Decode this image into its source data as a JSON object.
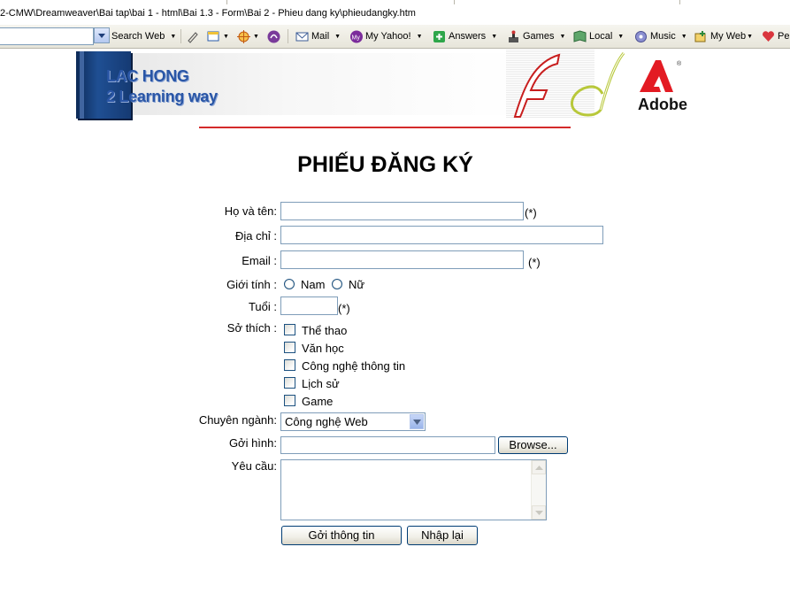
{
  "browser": {
    "path": "2-CMW\\Dreamweaver\\Bai tap\\bai 1 - html\\Bai 1.3 - Form\\Bai 2 - Phieu dang ky\\phieudangky.htm",
    "toolbar": {
      "search_label": "Search Web",
      "items": [
        {
          "label": "Mail",
          "icon": "mail-icon"
        },
        {
          "label": "My Yahoo!",
          "icon": "my-yahoo-icon"
        },
        {
          "label": "Answers",
          "icon": "answers-icon"
        },
        {
          "label": "Games",
          "icon": "games-icon"
        },
        {
          "label": "Local",
          "icon": "local-icon"
        },
        {
          "label": "Music",
          "icon": "music-icon"
        },
        {
          "label": "My Web",
          "icon": "my-web-icon"
        },
        {
          "label": "Per",
          "icon": "heart-icon"
        }
      ]
    }
  },
  "banner": {
    "brand_line1": "LAC HONG",
    "brand_line2": "2 Learning way",
    "adobe_label": "Adobe"
  },
  "form": {
    "title": "PHIẾU ĐĂNG KÝ",
    "required_mark": "(*)",
    "fields": {
      "fullname_label": "Họ và tên:",
      "address_label": "Địa chỉ :",
      "email_label": "Email :",
      "gender_label": "Giới tính :",
      "age_label": "Tuổi :",
      "hobby_label": "Sở thích :",
      "major_label": "Chuyên ngành:",
      "upload_label": "Gởi hình:",
      "request_label": "Yêu cầu:"
    },
    "gender_options": [
      "Nam",
      "Nữ"
    ],
    "hobbies": [
      "Thể thao",
      "Văn học",
      "Công nghệ thông tin",
      "Lịch sử",
      "Game"
    ],
    "major_selected": "Công nghệ Web",
    "browse_label": "Browse...",
    "submit_label": "Gởi thông tin",
    "reset_label": "Nhập lại"
  }
}
